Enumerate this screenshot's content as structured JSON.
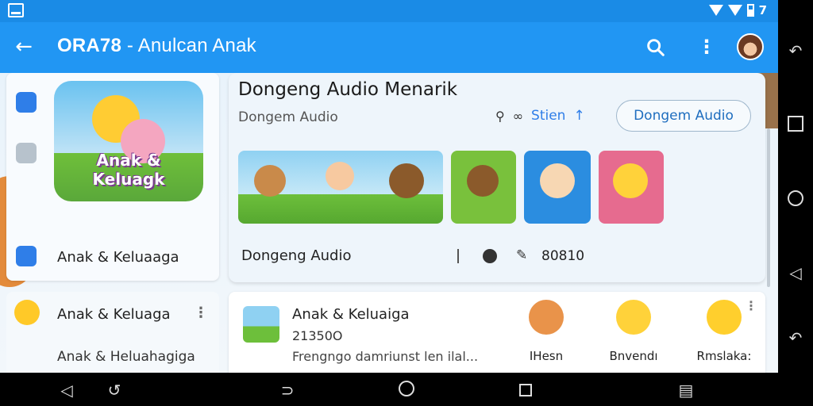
{
  "app": {
    "title_bold": "ORA78",
    "title_rest": " - Anulcan Anak"
  },
  "left_panel": {
    "feature_title": "Anak & Keluagk",
    "label": "Anak & Keluaaga"
  },
  "right_panel": {
    "title": "Dongeng Audio Menarik",
    "subtitle": "Dongem Audio",
    "search_text": "Stien",
    "button_label": "Dongem Audio",
    "bottom_label": "Dongeng Audio",
    "count": "80810"
  },
  "left_list": {
    "item1": "Anak & Keluaga",
    "item2": "Anak & Heluahagiga"
  },
  "card": {
    "title": "Anak & Keluaiga",
    "number": "21350O",
    "description": "Frengngo damriunst len ilal...",
    "characters": [
      {
        "name": "IHesn",
        "color": "#e9934a"
      },
      {
        "name": "Bnvendı",
        "color": "#ffd23a"
      },
      {
        "name": "Rmslaka:",
        "color": "#ffcf2d"
      }
    ]
  },
  "status": {
    "time": "7"
  },
  "colors": {
    "appbar": "#2196f3",
    "accent": "#1f6ebf"
  }
}
